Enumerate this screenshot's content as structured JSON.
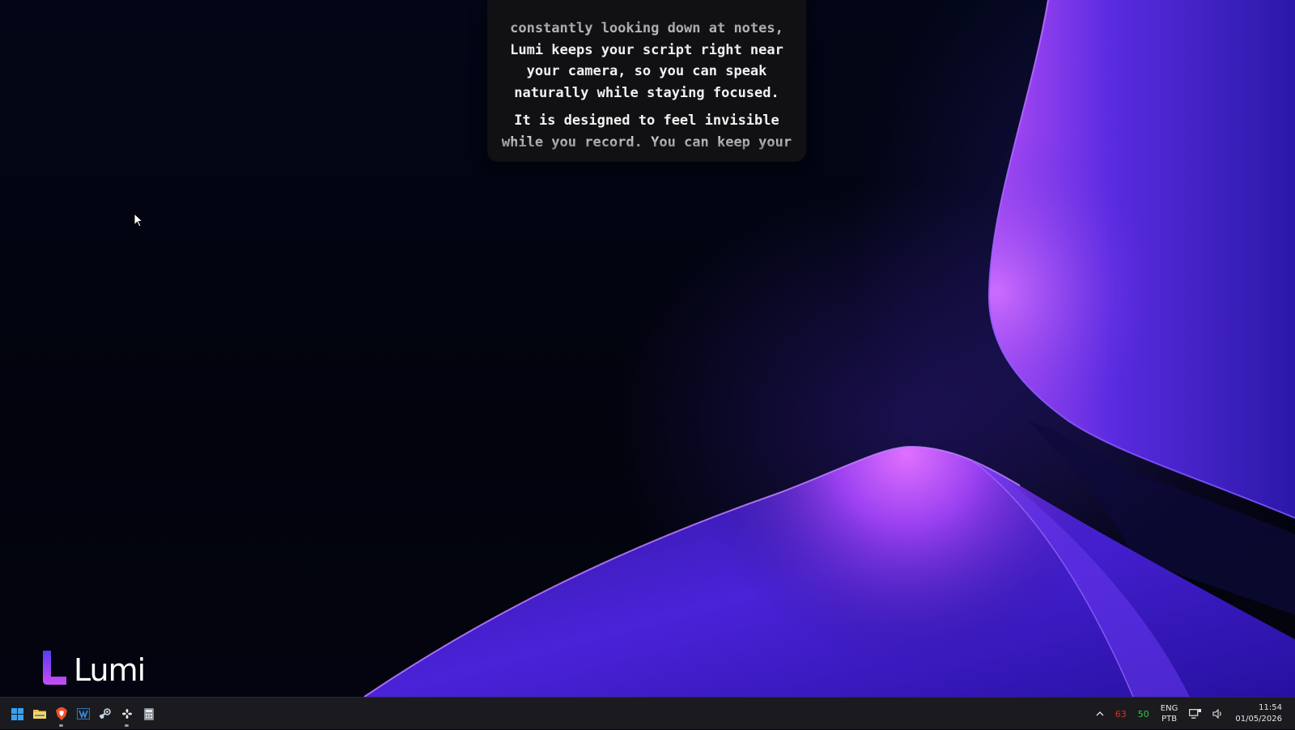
{
  "teleprompter": {
    "paragraphs": [
      {
        "lines": [
          "constantly looking down at notes,",
          "Lumi keeps your script right near",
          "your camera, so you can speak",
          "naturally while staying focused."
        ]
      },
      {
        "lines": [
          "It is designed to feel invisible",
          "while you record. You can keep your"
        ]
      }
    ]
  },
  "branding": {
    "app_name": "Lumi",
    "accent_gradient": [
      "#5b3cf0",
      "#c84cf5"
    ]
  },
  "taskbar": {
    "apps": [
      {
        "icon": "windows-start-icon",
        "running": false
      },
      {
        "icon": "file-explorer-icon",
        "running": false
      },
      {
        "icon": "brave-browser-icon",
        "running": true
      },
      {
        "icon": "visual-studio-icon",
        "running": false
      },
      {
        "icon": "steam-icon",
        "running": false
      },
      {
        "icon": "fan-utility-icon",
        "running": true
      },
      {
        "icon": "calculator-icon",
        "running": false
      }
    ],
    "tray": {
      "cpu_temp": "63",
      "gpu_temp": "50",
      "lang_primary": "ENG",
      "lang_secondary": "PTB",
      "time": "11:54",
      "date": "01/05/2026"
    }
  }
}
